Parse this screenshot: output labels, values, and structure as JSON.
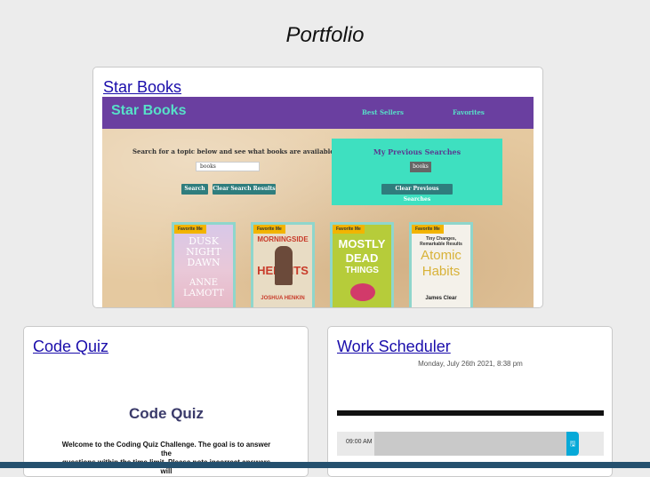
{
  "page": {
    "title": "Portfolio"
  },
  "cards": {
    "star_books": {
      "link": "Star Books",
      "preview": {
        "brand": "Star Books",
        "nav": [
          "Best Sellers",
          "Favorites"
        ],
        "search_prompt": "Search for a topic below and see what books are available!",
        "search_value": "books",
        "search_button": "Search",
        "clear_button": "Clear Search Results",
        "previous_title": "My Previous Searches",
        "previous_chip": "books",
        "clear_previous": "Clear Previous Searches",
        "favorite_label": "Favorite Me",
        "books": [
          {
            "line1": "DUSK",
            "line2": "NIGHT",
            "line3": "DAWN",
            "line4": "ANNE",
            "line5": "LAMOTT"
          },
          {
            "line1": "MORNINGSIDE",
            "line2": "HEIGHTS",
            "line3": "JOSHUA HENKIN"
          },
          {
            "line1": "MOSTLY",
            "line2": "DEAD",
            "line3": "THINGS"
          },
          {
            "line1": "Tiny Changes, Remarkable Results",
            "line2": "Atomic",
            "line3": "Habits",
            "line4": "James Clear"
          }
        ]
      }
    },
    "code_quiz": {
      "link": "Code Quiz",
      "preview": {
        "title": "Code Quiz",
        "body_line1": "Welcome to the Coding Quiz Challenge. The goal is to answer the",
        "body_line2": "questions within the time limit. Please note incorrect answers will"
      }
    },
    "work_scheduler": {
      "link": "Work Scheduler",
      "preview": {
        "date": "Monday, July 26th 2021, 8:38 pm",
        "hour": "09:00 AM",
        "save_glyph": "🖫"
      }
    }
  },
  "colors": {
    "nav_purple": "#6a3fa0",
    "teal": "#3ee0c0",
    "link_blue": "#1a0dab"
  }
}
